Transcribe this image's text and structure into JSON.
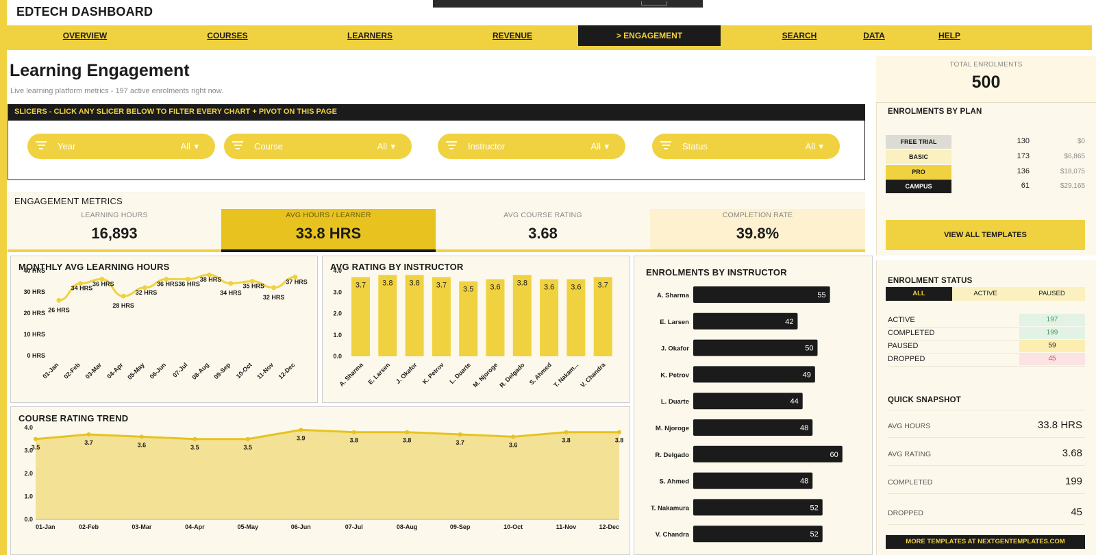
{
  "app": {
    "title": "EDTECH DASHBOARD"
  },
  "nav": {
    "items": [
      {
        "label": "OVERVIEW"
      },
      {
        "label": "COURSES"
      },
      {
        "label": "LEARNERS"
      },
      {
        "label": "REVENUE"
      },
      {
        "label": "> ENGAGEMENT"
      },
      {
        "label": "SEARCH"
      },
      {
        "label": "DATA"
      },
      {
        "label": "HELP"
      }
    ],
    "active_index": 4
  },
  "page": {
    "title": "Learning Engagement",
    "subtitle": "Live learning platform metrics  -  197 active enrolments right now."
  },
  "slicers": {
    "banner": "SLICERS  -  CLICK ANY SLICER BELOW TO FILTER EVERY CHART + PIVOT ON THIS PAGE",
    "items": [
      {
        "label": "Year",
        "value": "All"
      },
      {
        "label": "Course",
        "value": "All"
      },
      {
        "label": "Instructor",
        "value": "All"
      },
      {
        "label": "Status",
        "value": "All"
      }
    ]
  },
  "metrics": {
    "header": "ENGAGEMENT METRICS",
    "kpis": [
      {
        "label": "LEARNING HOURS",
        "value": "16,893"
      },
      {
        "label": "AVG HOURS / LEARNER",
        "value": "33.8 HRS"
      },
      {
        "label": "AVG COURSE RATING",
        "value": "3.68"
      },
      {
        "label": "COMPLETION RATE",
        "value": "39.8%"
      }
    ]
  },
  "colors": {
    "accent": "#f0d240",
    "accent_dark": "#e6c31f",
    "dark": "#1b1b1b",
    "panel": "#fcf8eb",
    "light_yellow": "#faf0c0",
    "active_green": "#e3f2e6",
    "completed_green": "#3c9a57",
    "paused_yellow": "#fbeeb0",
    "dropped_pink": "#fbe3e3",
    "dropped_red": "#d04b4b"
  },
  "chart_data": [
    {
      "type": "line",
      "title": "MONTHLY AVG LEARNING HOURS",
      "x": [
        "01-Jan",
        "02-Feb",
        "03-Mar",
        "04-Apr",
        "05-May",
        "06-Jun",
        "07-Jul",
        "08-Aug",
        "09-Sep",
        "10-Oct",
        "11-Nov",
        "12-Dec"
      ],
      "values": [
        26,
        34,
        36,
        28,
        32,
        36,
        36,
        38,
        34,
        35,
        32,
        37
      ],
      "data_labels": [
        "26 HRS",
        "34 HRS",
        "36 HRS",
        "28 HRS",
        "32 HRS",
        "36 HRS",
        "36 HRS",
        "38 HRS",
        "34 HRS",
        "35 HRS",
        "32 HRS",
        "37 HRS"
      ],
      "y_ticks": [
        "0 HRS",
        "10 HRS",
        "20 HRS",
        "30 HRS",
        "40 HRS"
      ],
      "ylim": [
        0,
        40
      ],
      "grid": false
    },
    {
      "type": "bar",
      "title": "AVG RATING BY INSTRUCTOR",
      "categories": [
        "A. Sharma",
        "E. Larsen",
        "J. Okafor",
        "K. Petrov",
        "L. Duarte",
        "M. Njoroge",
        "R. Delgado",
        "S. Ahmed",
        "T. Nakam...",
        "V. Chandra"
      ],
      "values": [
        3.7,
        3.8,
        3.8,
        3.7,
        3.5,
        3.6,
        3.8,
        3.6,
        3.6,
        3.7
      ],
      "y_ticks": [
        "0.0",
        "1.0",
        "2.0",
        "3.0",
        "4.0"
      ],
      "ylim": [
        0,
        4
      ],
      "grid": false
    },
    {
      "type": "bar",
      "orientation": "horizontal",
      "title": "ENROLMENTS BY INSTRUCTOR",
      "categories": [
        "A. Sharma",
        "E. Larsen",
        "J. Okafor",
        "K. Petrov",
        "L. Duarte",
        "M. Njoroge",
        "R. Delgado",
        "S. Ahmed",
        "T. Nakamura",
        "V. Chandra"
      ],
      "values": [
        55,
        42,
        50,
        49,
        44,
        48,
        60,
        48,
        52,
        52
      ]
    },
    {
      "type": "area",
      "title": "COURSE RATING TREND",
      "x": [
        "01-Jan",
        "02-Feb",
        "03-Mar",
        "04-Apr",
        "05-May",
        "06-Jun",
        "07-Jul",
        "08-Aug",
        "09-Sep",
        "10-Oct",
        "11-Nov",
        "12-Dec"
      ],
      "values": [
        3.5,
        3.7,
        3.6,
        3.5,
        3.5,
        3.9,
        3.8,
        3.8,
        3.7,
        3.6,
        3.8,
        3.8
      ],
      "y_ticks": [
        "0.0",
        "1.0",
        "2.0",
        "3.0",
        "4.0"
      ],
      "ylim": [
        0,
        4
      ],
      "grid": false
    }
  ],
  "side": {
    "total_label": "TOTAL ENROLMENTS",
    "total_value": "500",
    "plans_title": "ENROLMENTS BY PLAN",
    "plans": [
      {
        "name": "FREE TRIAL",
        "count": "130",
        "amount": "$0"
      },
      {
        "name": "BASIC",
        "count": "173",
        "amount": "$6,865"
      },
      {
        "name": "PRO",
        "count": "136",
        "amount": "$18,075"
      },
      {
        "name": "CAMPUS",
        "count": "61",
        "amount": "$29,165"
      }
    ],
    "templates_button": "VIEW ALL TEMPLATES",
    "status_title": "ENROLMENT STATUS",
    "status_tabs": [
      "ALL",
      "ACTIVE",
      "PAUSED"
    ],
    "status_rows": [
      {
        "label": "ACTIVE",
        "value": "197"
      },
      {
        "label": "COMPLETED",
        "value": "199"
      },
      {
        "label": "PAUSED",
        "value": "59"
      },
      {
        "label": "DROPPED",
        "value": "45"
      }
    ],
    "snapshot_title": "QUICK SNAPSHOT",
    "snapshot_rows": [
      {
        "label": "AVG HOURS",
        "value": "33.8 HRS"
      },
      {
        "label": "AVG RATING",
        "value": "3.68"
      },
      {
        "label": "COMPLETED",
        "value": "199"
      },
      {
        "label": "DROPPED",
        "value": "45"
      }
    ],
    "more_templates": "MORE TEMPLATES AT NEXTGENTEMPLATES.COM"
  }
}
